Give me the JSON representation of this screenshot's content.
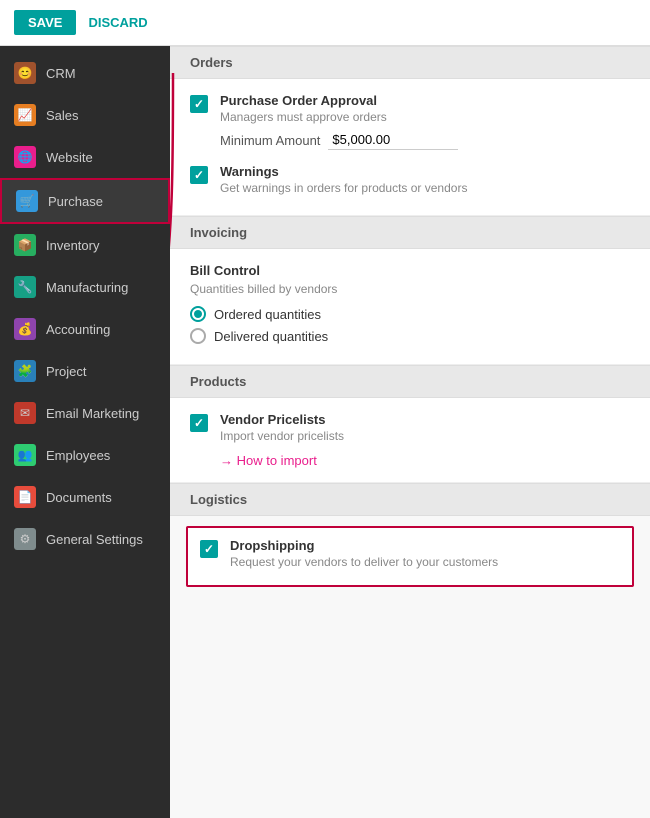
{
  "topbar": {
    "save_label": "SAVE",
    "discard_label": "DISCARD"
  },
  "sidebar": {
    "items": [
      {
        "id": "crm",
        "label": "CRM",
        "icon": "crm",
        "icon_char": "👤"
      },
      {
        "id": "sales",
        "label": "Sales",
        "icon": "sales",
        "icon_char": "📊"
      },
      {
        "id": "website",
        "label": "Website",
        "icon": "website",
        "icon_char": "🌐"
      },
      {
        "id": "purchase",
        "label": "Purchase",
        "icon": "purchase",
        "icon_char": "🛒",
        "active": true
      },
      {
        "id": "inventory",
        "label": "Inventory",
        "icon": "inventory",
        "icon_char": "📦"
      },
      {
        "id": "manufacturing",
        "label": "Manufacturing",
        "icon": "manufacturing",
        "icon_char": "🔧"
      },
      {
        "id": "accounting",
        "label": "Accounting",
        "icon": "accounting",
        "icon_char": "💰"
      },
      {
        "id": "project",
        "label": "Project",
        "icon": "project",
        "icon_char": "🧩"
      },
      {
        "id": "email",
        "label": "Email Marketing",
        "icon": "email",
        "icon_char": "✉"
      },
      {
        "id": "employees",
        "label": "Employees",
        "icon": "employees",
        "icon_char": "👥"
      },
      {
        "id": "documents",
        "label": "Documents",
        "icon": "documents",
        "icon_char": "📄"
      },
      {
        "id": "settings",
        "label": "General Settings",
        "icon": "settings",
        "icon_char": "⚙"
      }
    ]
  },
  "sections": {
    "orders": {
      "title": "Orders",
      "purchase_order_approval": {
        "label": "Purchase Order Approval",
        "desc": "Managers must approve orders",
        "checked": true,
        "minimum_amount_label": "Minimum Amount",
        "minimum_amount_value": "$5,000.00"
      },
      "warnings": {
        "label": "Warnings",
        "desc": "Get warnings in orders for products or vendors",
        "checked": true
      }
    },
    "invoicing": {
      "title": "Invoicing",
      "bill_control": {
        "label": "Bill Control",
        "desc": "Quantities billed by vendors",
        "options": [
          {
            "id": "ordered",
            "label": "Ordered quantities",
            "selected": true
          },
          {
            "id": "delivered",
            "label": "Delivered quantities",
            "selected": false
          }
        ]
      }
    },
    "products": {
      "title": "Products",
      "vendor_pricelists": {
        "label": "Vendor Pricelists",
        "desc": "Import vendor pricelists",
        "checked": true,
        "how_to_import": "→ How to import"
      }
    },
    "logistics": {
      "title": "Logistics",
      "dropshipping": {
        "label": "Dropshipping",
        "desc": "Request your vendors to deliver to your customers",
        "checked": true
      }
    }
  }
}
